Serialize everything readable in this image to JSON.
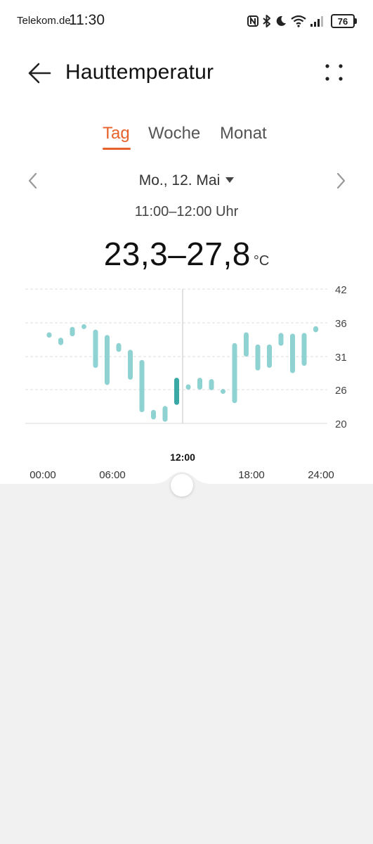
{
  "status": {
    "carrier": "Telekom.de",
    "time": "11:30",
    "battery": "76",
    "icons": [
      "nfc-icon",
      "bluetooth-icon",
      "moon-icon",
      "wifi-icon",
      "signal-icon",
      "battery-icon"
    ]
  },
  "header": {
    "title": "Hauttemperatur",
    "back_icon": "arrow-left-icon",
    "more_icon": "more-dots-icon"
  },
  "tabs": [
    {
      "label": "Tag",
      "active": true
    },
    {
      "label": "Woche",
      "active": false
    },
    {
      "label": "Monat",
      "active": false
    }
  ],
  "date": {
    "label": "Mo., 12. Mai",
    "range": "11:00–12:00 Uhr"
  },
  "reading": {
    "value": "23,3–27,8",
    "unit": "°C"
  },
  "accent_color": "#e6622a",
  "bar_color": "#8fd2d2",
  "bar_selected_color": "#3aa9a5",
  "chart_data": {
    "type": "range-bar",
    "yticks": [
      "42",
      "36",
      "31",
      "26",
      "20"
    ],
    "y_values": [
      42,
      36,
      31,
      26,
      20
    ],
    "ylim": [
      20,
      42
    ],
    "xticks": [
      "00:00",
      "06:00",
      "18:00",
      "24:00"
    ],
    "selected_label": "12:00",
    "selected_index": 11,
    "bars": [
      {
        "hour": 0,
        "min": 33.8,
        "max": 34.6
      },
      {
        "hour": 1,
        "min": 32.7,
        "max": 33.8
      },
      {
        "hour": 2,
        "min": 34.0,
        "max": 35.4
      },
      {
        "hour": 3,
        "min": 35.2,
        "max": 35.8
      },
      {
        "hour": 4,
        "min": 29.3,
        "max": 35.0
      },
      {
        "hour": 5,
        "min": 26.7,
        "max": 34.2
      },
      {
        "hour": 6,
        "min": 31.7,
        "max": 33.0
      },
      {
        "hour": 7,
        "min": 27.5,
        "max": 32.0
      },
      {
        "hour": 8,
        "min": 22.0,
        "max": 30.5
      },
      {
        "hour": 9,
        "min": 20.7,
        "max": 22.4
      },
      {
        "hour": 10,
        "min": 20.3,
        "max": 23.1
      },
      {
        "hour": 11,
        "min": 23.3,
        "max": 27.8
      },
      {
        "hour": 12,
        "min": 26.0,
        "max": 26.8
      },
      {
        "hour": 13,
        "min": 26.0,
        "max": 27.8
      },
      {
        "hour": 14,
        "min": 25.9,
        "max": 27.6
      },
      {
        "hour": 15,
        "min": 25.6,
        "max": 26.1
      },
      {
        "hour": 16,
        "min": 23.6,
        "max": 33.0
      },
      {
        "hour": 17,
        "min": 31.0,
        "max": 34.6
      },
      {
        "hour": 18,
        "min": 28.9,
        "max": 32.8
      },
      {
        "hour": 19,
        "min": 29.3,
        "max": 32.8
      },
      {
        "hour": 20,
        "min": 32.6,
        "max": 34.5
      },
      {
        "hour": 21,
        "min": 28.5,
        "max": 34.4
      },
      {
        "hour": 22,
        "min": 29.6,
        "max": 34.5
      },
      {
        "hour": 23,
        "min": 34.6,
        "max": 35.5
      }
    ]
  }
}
